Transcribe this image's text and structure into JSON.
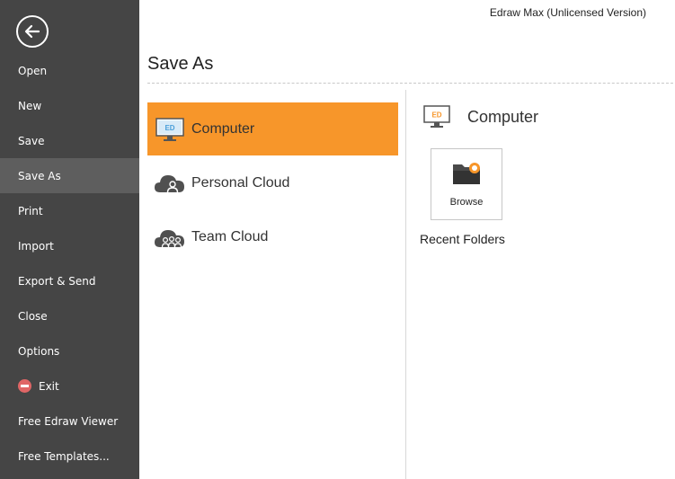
{
  "app": {
    "title": "Edraw Max (Unlicensed Version)"
  },
  "sidebar": {
    "items": [
      {
        "label": "Open"
      },
      {
        "label": "New"
      },
      {
        "label": "Save"
      },
      {
        "label": "Save As"
      },
      {
        "label": "Print"
      },
      {
        "label": "Import"
      },
      {
        "label": "Export & Send"
      },
      {
        "label": "Close"
      },
      {
        "label": "Options"
      },
      {
        "label": "Exit"
      },
      {
        "label": "Free Edraw Viewer"
      },
      {
        "label": "Free Templates..."
      }
    ],
    "active": "Save As"
  },
  "page": {
    "title": "Save As"
  },
  "locations": [
    {
      "label": "Computer",
      "icon": "computer-icon",
      "selected": true
    },
    {
      "label": "Personal Cloud",
      "icon": "personal-cloud-icon"
    },
    {
      "label": "Team Cloud",
      "icon": "team-cloud-icon"
    }
  ],
  "right": {
    "header": "Computer",
    "browse_label": "Browse",
    "recent_folders_label": "Recent Folders"
  },
  "icon_text": {
    "ed": "ED"
  },
  "colors": {
    "sidebar_bg": "#454545",
    "sidebar_active": "#5e5e5e",
    "accent": "#f7962a",
    "exit_red": "#e06666"
  }
}
